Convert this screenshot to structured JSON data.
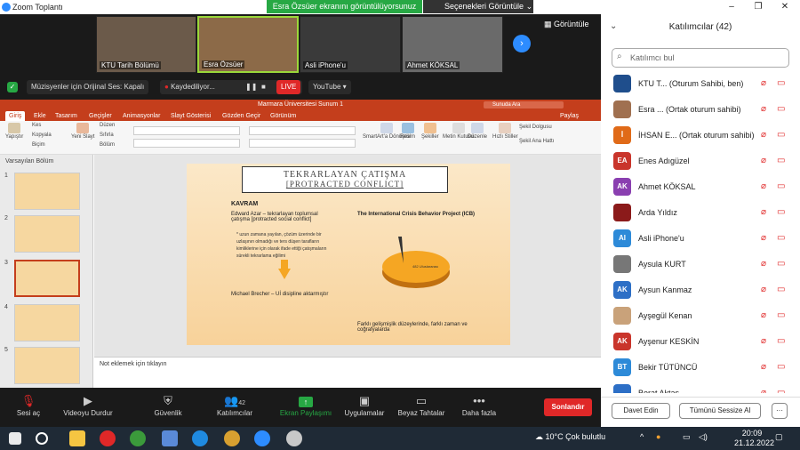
{
  "window": {
    "title": "Zoom Toplantı"
  },
  "share": {
    "banner": "Esra Özsüer ekranını görüntülüyorsunuz",
    "options": "Seçenekleri Görüntüle"
  },
  "gallery": {
    "tiles": [
      "KTU Tarih Bölümü",
      "Esra Özsüer",
      "Asli iPhone'u",
      "Ahmet KÖKSAL"
    ],
    "view_label": "Görüntüle"
  },
  "status": {
    "music": "Müzisyenler için Orijinal Ses: Kapalı",
    "recording": "Kaydediliyor...",
    "live": "LIVE",
    "youtube": "YouTube"
  },
  "ppt": {
    "title": "Marmara Üniversitesi Sunum 1",
    "search": "Sunuda Ara",
    "share": "Paylaş",
    "tabs": [
      "Giriş",
      "Ekle",
      "Tasarım",
      "Geçişler",
      "Animasyonlar",
      "Slayt Gösterisi",
      "Gözden Geçir",
      "Görünüm"
    ],
    "ribbon": {
      "paste": "Yapıştır",
      "cut": "Kes",
      "copy": "Kopyala",
      "format": "Biçim",
      "new_slide": "Yeni Slayt",
      "layout": "Düzen",
      "reset": "Sıfırla",
      "section": "Bölüm",
      "smartart": "SmartArt'a Dönüştür",
      "picture": "Resim",
      "shapes": "Şekiller",
      "textbox": "Metin Kutusu",
      "arrange": "Düzenle",
      "quick_styles": "Hızlı Stiller",
      "fill": "Şekil Dolgusu",
      "outline": "Şekil Ana Hattı"
    },
    "section_label": "Varsayılan Bölüm",
    "slide_numbers": [
      "1",
      "2",
      "3",
      "4",
      "5"
    ],
    "notes_placeholder": "Not eklemek için tıklayın",
    "slide": {
      "title_line1": "TEKRARLAYAN ÇATIŞMA",
      "title_line2": "[PROTRACTED CONFLICT]",
      "kavram": "KAVRAM",
      "azar": "Edward Azar – tekrarlayan toplumsal çatışma [protracted social conflict]",
      "bullet": "* uzun zamana yayılan, çözüm üzerinde bir uzlaşının olmadığı ve ters düşen tarafların kimliklerine için olarak ifade ettiği çatışmaların sürekli tekrarlama eğilimi",
      "brecher": "Michael Brecher – Uİ disipline aktarmıştır",
      "icb": "The International Crisis Behavior Project (ICB)",
      "pie_label": "482 Uluslararası",
      "bottom": "Farklı gelişmişlik düzeylerinde, farklı zaman ve coğrafyalarda"
    }
  },
  "toolbar": {
    "mute": "Sesi aç",
    "video": "Videoyu Durdur",
    "security": "Güvenlik",
    "participants": "Katılımcılar",
    "participants_count": "42",
    "share": "Ekran Paylaşımı",
    "apps": "Uygulamalar",
    "whiteboard": "Beyaz Tahtalar",
    "more": "Daha fazla",
    "end": "Sonlandır"
  },
  "panel": {
    "title": "Katılımcılar (42)",
    "search_placeholder": "Katılımcı bul",
    "participants": [
      {
        "initials": "",
        "name": "KTU T... (Oturum Sahibi, ben)",
        "color": "#1f4e8c"
      },
      {
        "initials": "",
        "name": "Esra ... (Ortak oturum sahibi)",
        "color": "#a07050"
      },
      {
        "initials": "İ",
        "name": "İHSAN E... (Ortak oturum sahibi)",
        "color": "#e06a18"
      },
      {
        "initials": "EA",
        "name": "Enes Adıgüzel",
        "color": "#c9352b"
      },
      {
        "initials": "AK",
        "name": "Ahmet KÖKSAL",
        "color": "#8a3fb0"
      },
      {
        "initials": "",
        "name": "Arda Yıldız",
        "color": "#8b1a1a"
      },
      {
        "initials": "AI",
        "name": "Asli iPhone'u",
        "color": "#2d8ad8"
      },
      {
        "initials": "",
        "name": "Aysula KURT",
        "color": "#777"
      },
      {
        "initials": "AK",
        "name": "Aysun Kanmaz",
        "color": "#2d6fc6"
      },
      {
        "initials": "",
        "name": "Ayşegül Kenan",
        "color": "#c9a27a"
      },
      {
        "initials": "AK",
        "name": "Ayşenur KESKİN",
        "color": "#c9352b"
      },
      {
        "initials": "BT",
        "name": "Bekir TÜTÜNCÜ",
        "color": "#2d8ad8"
      },
      {
        "initials": "",
        "name": "Berat Aktaş",
        "color": "#2d6fc6"
      }
    ],
    "invite": "Davet Edin",
    "mute_all": "Tümünü Sessize Al",
    "more": "···"
  },
  "taskbar": {
    "weather": "10°C Çok bulutlu",
    "time": "20:09",
    "date": "21.12.2022"
  }
}
